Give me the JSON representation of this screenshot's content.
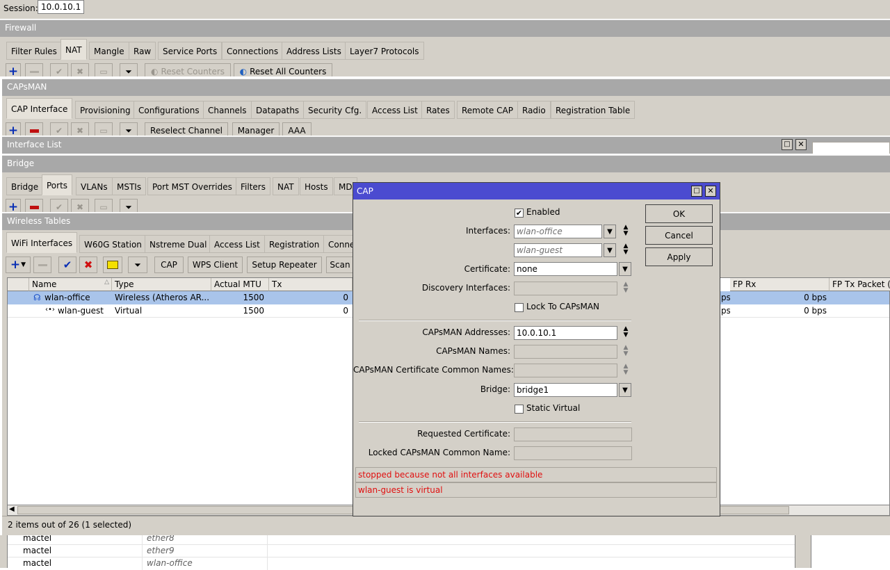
{
  "session": {
    "label": "Session:",
    "value": "10.0.10.1"
  },
  "firewall": {
    "title": "Firewall",
    "tabs": [
      "Filter Rules",
      "NAT",
      "Mangle",
      "Raw",
      "Service Ports",
      "Connections",
      "Address Lists",
      "Layer7 Protocols"
    ],
    "active_tab": "NAT",
    "reset_counters": "Reset Counters",
    "reset_all_counters": "Reset All Counters"
  },
  "capsman": {
    "title": "CAPsMAN",
    "tabs": [
      "CAP Interface",
      "Provisioning",
      "Configurations",
      "Channels",
      "Datapaths",
      "Security Cfg.",
      "Access List",
      "Rates",
      "Remote CAP",
      "Radio",
      "Registration Table"
    ],
    "active_tab": "CAP Interface",
    "reselect_channel": "Reselect Channel",
    "manager": "Manager",
    "aaa": "AAA"
  },
  "interface_list": {
    "title": "Interface List"
  },
  "bridge": {
    "title": "Bridge",
    "tabs": [
      "Bridge",
      "Ports",
      "VLANs",
      "MSTIs",
      "Port MST Overrides",
      "Filters",
      "NAT",
      "Hosts",
      "MD"
    ],
    "active_tab": "Ports",
    "bottom_rows": [
      {
        "name": "mactel",
        "iface": "ether8"
      },
      {
        "name": "mactel",
        "iface": "ether9"
      },
      {
        "name": "mactel",
        "iface": "wlan-office"
      }
    ]
  },
  "wireless": {
    "title": "Wireless Tables",
    "tabs": [
      "WiFi Interfaces",
      "W60G Station",
      "Nstreme Dual",
      "Access List",
      "Registration",
      "Conne"
    ],
    "active_tab": "WiFi Interfaces",
    "toolbar": {
      "cap": "CAP",
      "wps_client": "WPS Client",
      "setup_repeater": "Setup Repeater",
      "scan": "Scan"
    },
    "columns": [
      "Name",
      "Type",
      "Actual MTU",
      "Tx",
      "FP Rx",
      "FP Tx Packet (p"
    ],
    "rows": [
      {
        "name": "wlan-office",
        "type": "Wireless (Atheros AR...",
        "mtu": "1500",
        "tx": "0",
        "rx_tail": "ps",
        "fp_rx": "0 bps"
      },
      {
        "name": "wlan-guest",
        "type": "Virtual",
        "mtu": "1500",
        "tx": "0",
        "rx_tail": "ps",
        "fp_rx": "0 bps"
      }
    ],
    "status": "2 items out of 26 (1 selected)"
  },
  "cap_dialog": {
    "title": "CAP",
    "enabled_label": "Enabled",
    "enabled": true,
    "interfaces_label": "Interfaces:",
    "interfaces": [
      "wlan-office",
      "wlan-guest"
    ],
    "certificate_label": "Certificate:",
    "certificate": "none",
    "discovery_label": "Discovery Interfaces:",
    "discovery": "",
    "lock_label": "Lock To CAPsMAN",
    "capsman_addresses_label": "CAPsMAN Addresses:",
    "capsman_addresses": "10.0.10.1",
    "capsman_names_label": "CAPsMAN Names:",
    "capsman_cert_names_label": "CAPsMAN Certificate Common Names:",
    "bridge_label": "Bridge:",
    "bridge": "bridge1",
    "static_virtual_label": "Static Virtual",
    "requested_cert_label": "Requested Certificate:",
    "locked_cn_label": "Locked CAPsMAN Common Name:",
    "ok": "OK",
    "cancel": "Cancel",
    "apply": "Apply",
    "messages": [
      "stopped because not all interfaces available",
      "wlan-guest is virtual"
    ],
    "colors": {
      "title_bar": "#4b4bd0",
      "error_text": "#e01010"
    }
  }
}
